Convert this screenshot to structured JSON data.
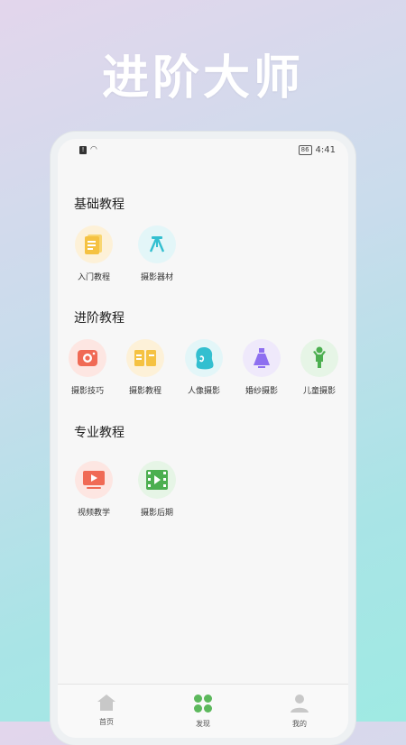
{
  "headline": "进阶大师",
  "status": {
    "battery": "86",
    "time": "4:41"
  },
  "sections": [
    {
      "title": "基础教程",
      "items": [
        {
          "label": "入门教程",
          "icon": "document-icon",
          "bg": "#fdf1d8",
          "color": "#f5c242"
        },
        {
          "label": "摄影器材",
          "icon": "studio-light-icon",
          "bg": "#e3f6f8",
          "color": "#33bfd0"
        }
      ]
    },
    {
      "title": "进阶教程",
      "items": [
        {
          "label": "摄影技巧",
          "icon": "camera-icon",
          "bg": "#fde6e2",
          "color": "#f06a55"
        },
        {
          "label": "摄影教程",
          "icon": "open-book-icon",
          "bg": "#fdf1d8",
          "color": "#f5c242"
        },
        {
          "label": "人像摄影",
          "icon": "portrait-icon",
          "bg": "#e3f6f8",
          "color": "#33bfd0"
        },
        {
          "label": "婚纱摄影",
          "icon": "wedding-dress-icon",
          "bg": "#efe9fb",
          "color": "#8e6ff0"
        },
        {
          "label": "儿童摄影",
          "icon": "child-icon",
          "bg": "#e6f5e6",
          "color": "#4caf50"
        }
      ]
    },
    {
      "title": "专业教程",
      "items": [
        {
          "label": "视频教学",
          "icon": "video-play-icon",
          "bg": "#fde6e2",
          "color": "#f06a55"
        },
        {
          "label": "摄影后期",
          "icon": "film-icon",
          "bg": "#e6f5e6",
          "color": "#4caf50"
        }
      ]
    }
  ],
  "tabs": [
    {
      "label": "首页",
      "icon": "home-icon"
    },
    {
      "label": "发现",
      "icon": "grid-icon",
      "active_color": "#5cb85c"
    },
    {
      "label": "我的",
      "icon": "user-icon"
    }
  ]
}
